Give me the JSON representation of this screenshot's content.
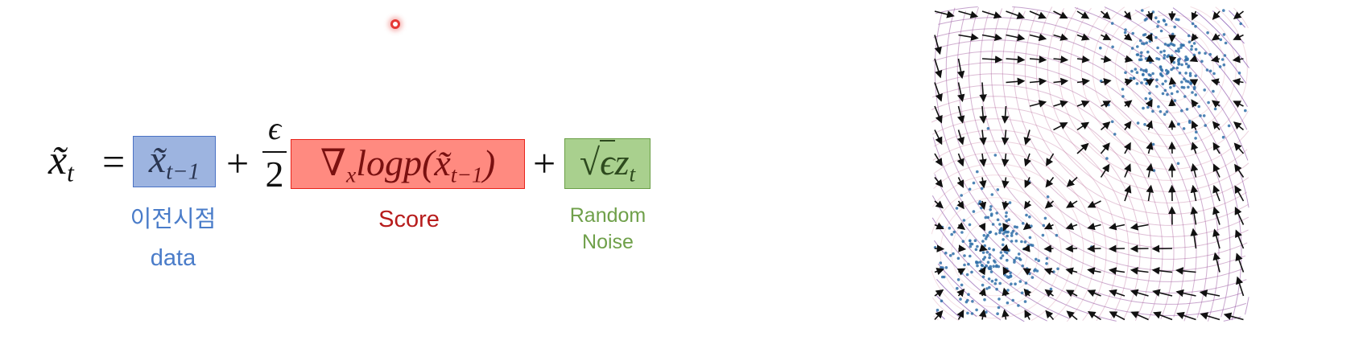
{
  "equation": {
    "lhs_var": "x̃",
    "lhs_sub": "t",
    "equals": "=",
    "term1_var": "x̃",
    "term1_sub": "t−1",
    "plus1": "+",
    "frac_num": "ϵ",
    "frac_den": "2",
    "score_nabla": "∇",
    "score_nabla_sub": "x",
    "score_body": "logp(x̃",
    "score_sub": "t−1",
    "score_close": ")",
    "plus2": "+",
    "noise_sqrt": "√",
    "noise_eps": "ϵ",
    "noise_z": "z",
    "noise_sub": "t"
  },
  "labels": {
    "prev_line1": "이전시점",
    "prev_line2": "data",
    "score": "Score",
    "noise_line1": "Random",
    "noise_line2": "Noise"
  },
  "colors": {
    "prev_box": "#9db4e0",
    "prev_border": "#4a72c4",
    "prev_text": "#4a7cc9",
    "score_box": "#ff8a80",
    "score_border": "#e8231b",
    "score_text": "#b71c1c",
    "noise_box": "#a9d08e",
    "noise_border": "#6a9f46",
    "noise_text": "#6fa04a",
    "points": "#2f6fa8",
    "arrows": "#111111"
  },
  "plot": {
    "modes": [
      [
        0.75,
        0.2
      ],
      [
        0.2,
        0.78
      ]
    ]
  }
}
